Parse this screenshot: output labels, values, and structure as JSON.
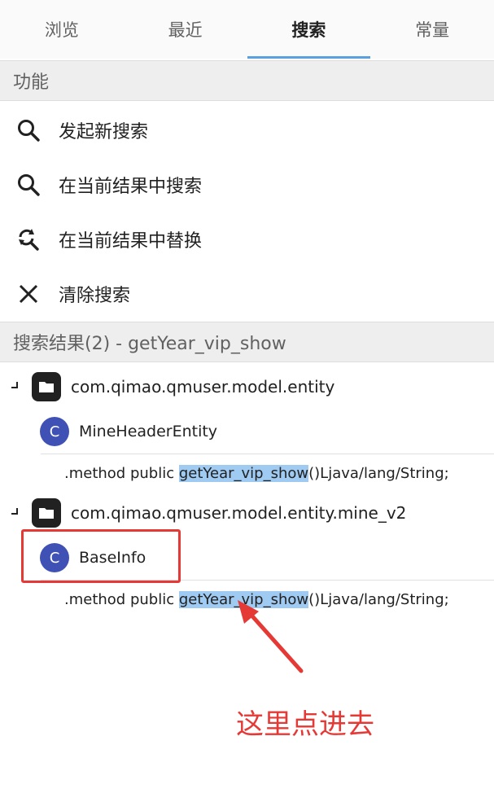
{
  "tabs": [
    {
      "label": "浏览",
      "active": false
    },
    {
      "label": "最近",
      "active": false
    },
    {
      "label": "搜索",
      "active": true
    },
    {
      "label": "常量",
      "active": false
    }
  ],
  "functions_header": "功能",
  "functions": [
    {
      "label": "发起新搜索",
      "icon": "search-icon"
    },
    {
      "label": "在当前结果中搜索",
      "icon": "search-icon"
    },
    {
      "label": "在当前结果中替换",
      "icon": "replace-icon"
    },
    {
      "label": "清除搜索",
      "icon": "close-icon"
    }
  ],
  "results_header": "搜索结果(2) - getYear_vip_show",
  "results": [
    {
      "package": "com.qimao.qmuser.model.entity",
      "class_badge": "C",
      "class_name": "MineHeaderEntity",
      "method_prefix": ".method public ",
      "method_match": "getYear_vip_show",
      "method_suffix": "()Ljava/lang/String;"
    },
    {
      "package": "com.qimao.qmuser.model.entity.mine_v2",
      "class_badge": "C",
      "class_name": "BaseInfo",
      "method_prefix": ".method public ",
      "method_match": "getYear_vip_show",
      "method_suffix": "()Ljava/lang/String;"
    }
  ],
  "annotation": {
    "text": "这里点进去",
    "color": "#e53935"
  },
  "colors": {
    "accent": "#5a9fe0",
    "highlight": "#9fcbf3",
    "class_badge": "#3f51b5"
  }
}
